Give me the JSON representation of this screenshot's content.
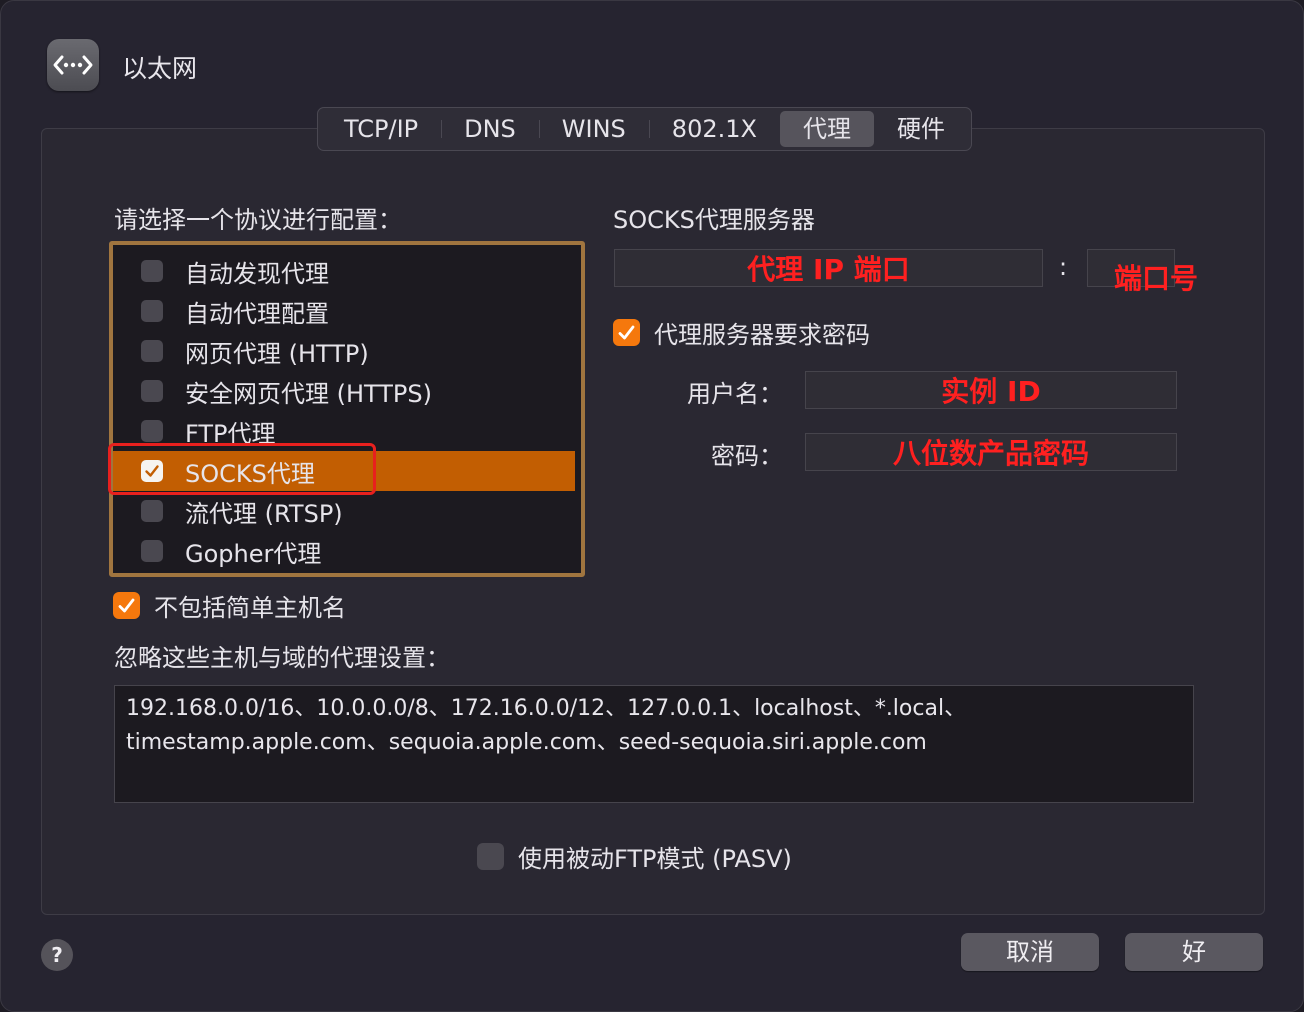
{
  "window": {
    "title": "以太网",
    "icon": "ethernet-icon"
  },
  "tabs": [
    {
      "label": "TCP/IP",
      "active": false
    },
    {
      "label": "DNS",
      "active": false
    },
    {
      "label": "WINS",
      "active": false
    },
    {
      "label": "802.1X",
      "active": false
    },
    {
      "label": "代理",
      "active": true
    },
    {
      "label": "硬件",
      "active": false
    }
  ],
  "protocols": {
    "heading": "请选择一个协议进行配置：",
    "items": [
      {
        "label": "自动发现代理",
        "checked": false
      },
      {
        "label": "自动代理配置",
        "checked": false
      },
      {
        "label": "网页代理 (HTTP)",
        "checked": false
      },
      {
        "label": "安全网页代理 (HTTPS)",
        "checked": false
      },
      {
        "label": "FTP代理",
        "checked": false
      },
      {
        "label": "SOCKS代理",
        "checked": true,
        "selected": true
      },
      {
        "label": "流代理 (RTSP)",
        "checked": false
      },
      {
        "label": "Gopher代理",
        "checked": false
      }
    ]
  },
  "socks": {
    "heading": "SOCKS代理服务器",
    "server_value": "代理 IP 端口",
    "colon": ":",
    "port_value": "端口号",
    "require_password": {
      "label": "代理服务器要求密码",
      "checked": true
    },
    "username_label": "用户名：",
    "username_value": "实例 ID",
    "password_label": "密码：",
    "password_value": "八位数产品密码"
  },
  "exclude_simple": {
    "label": "不包括简单主机名",
    "checked": true
  },
  "bypass": {
    "heading": "忽略这些主机与域的代理设置：",
    "line1": "192.168.0.0/16、10.0.0.0/8、172.16.0.0/12、127.0.0.1、localhost、*.local、",
    "line2": "timestamp.apple.com、sequoia.apple.com、seed-sequoia.siri.apple.com"
  },
  "pasv": {
    "label": "使用被动FTP模式 (PASV)",
    "checked": false
  },
  "buttons": {
    "help": "?",
    "cancel": "取消",
    "ok": "好"
  },
  "colors": {
    "accent": "#f5780d",
    "selection": "#c25e02",
    "annotation_red": "#ff2020"
  }
}
